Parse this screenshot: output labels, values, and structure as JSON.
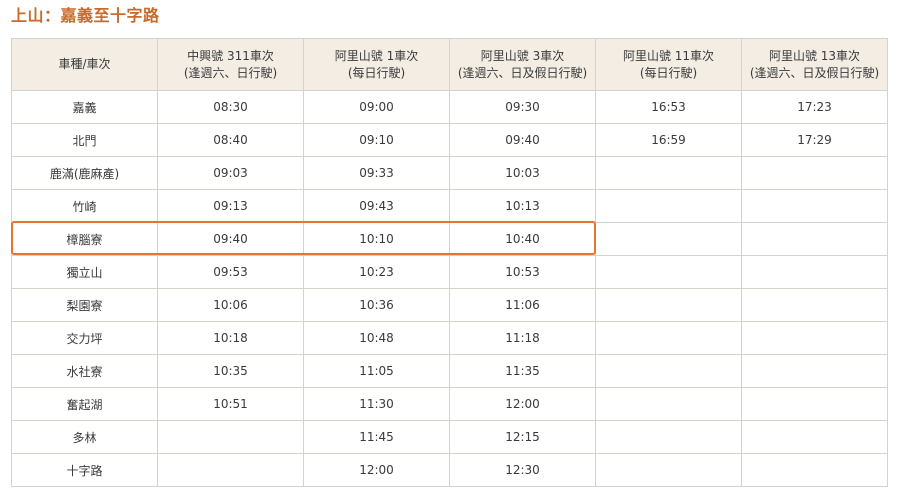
{
  "title": "上山：嘉義至十字路",
  "table": {
    "headers": [
      {
        "line1": "車種/車次",
        "line2": ""
      },
      {
        "line1": "中興號 311車次",
        "line2": "(逢週六、日行駛)"
      },
      {
        "line1": "阿里山號 1車次",
        "line2": "(每日行駛)"
      },
      {
        "line1": "阿里山號 3車次",
        "line2": "(逢週六、日及假日行駛)"
      },
      {
        "line1": "阿里山號 11車次",
        "line2": "(每日行駛)"
      },
      {
        "line1": "阿里山號 13車次",
        "line2": "(逢週六、日及假日行駛)"
      }
    ],
    "rows": [
      {
        "station": "嘉義",
        "times": [
          "08:30",
          "09:00",
          "09:30",
          "16:53",
          "17:23"
        ]
      },
      {
        "station": "北門",
        "times": [
          "08:40",
          "09:10",
          "09:40",
          "16:59",
          "17:29"
        ]
      },
      {
        "station": "鹿滿(鹿麻產)",
        "times": [
          "09:03",
          "09:33",
          "10:03",
          "",
          ""
        ]
      },
      {
        "station": "竹崎",
        "times": [
          "09:13",
          "09:43",
          "10:13",
          "",
          ""
        ]
      },
      {
        "station": "樟腦寮",
        "times": [
          "09:40",
          "10:10",
          "10:40",
          "",
          ""
        ]
      },
      {
        "station": "獨立山",
        "times": [
          "09:53",
          "10:23",
          "10:53",
          "",
          ""
        ]
      },
      {
        "station": "梨園寮",
        "times": [
          "10:06",
          "10:36",
          "11:06",
          "",
          ""
        ]
      },
      {
        "station": "交力坪",
        "times": [
          "10:18",
          "10:48",
          "11:18",
          "",
          ""
        ]
      },
      {
        "station": "水社寮",
        "times": [
          "10:35",
          "11:05",
          "11:35",
          "",
          ""
        ]
      },
      {
        "station": "奮起湖",
        "times": [
          "10:51",
          "11:30",
          "12:00",
          "",
          ""
        ]
      },
      {
        "station": "多林",
        "times": [
          "",
          "11:45",
          "12:15",
          "",
          ""
        ]
      },
      {
        "station": "十字路",
        "times": [
          "",
          "12:00",
          "12:30",
          "",
          ""
        ]
      }
    ]
  },
  "colors": {
    "title": "#c96a2a",
    "header_bg": "#f3ede4",
    "border": "#d6d2cc",
    "highlight": "#e8742e"
  }
}
